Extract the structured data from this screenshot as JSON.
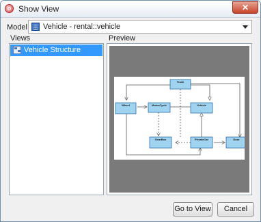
{
  "window": {
    "title": "Show View"
  },
  "model": {
    "label": "Model:",
    "value": "Vehicle - rental::vehicle"
  },
  "views": {
    "header": "Views",
    "items": [
      {
        "label": "Vehicle Structure",
        "selected": true
      }
    ]
  },
  "preview": {
    "header": "Preview",
    "diagram": {
      "classes": [
        "Truck",
        "Wheel",
        "MotorCycle",
        "Vehicle",
        "GearBox",
        "PrivateCar",
        "Door"
      ]
    }
  },
  "buttons": {
    "go_to_view": "Go to View",
    "cancel": "Cancel"
  },
  "colors": {
    "selection": "#3399ff",
    "class_fill": "#9fd3f0",
    "class_border": "#2c6da5",
    "preview_bg": "#7a7a7a"
  }
}
